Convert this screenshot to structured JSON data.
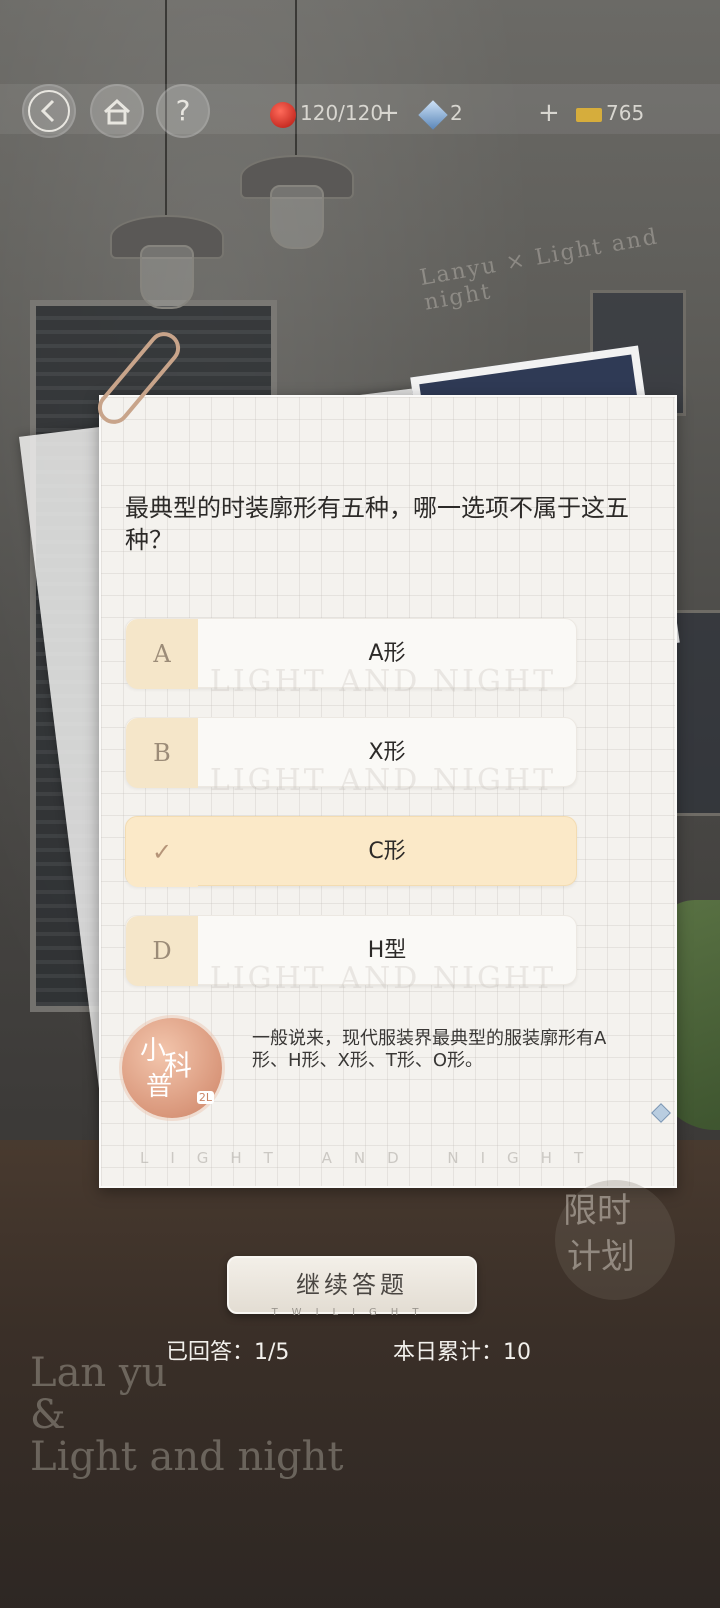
{
  "topbar": {
    "back_icon": "back-arrow-icon",
    "home_icon": "home-icon",
    "help_label": "?",
    "stamina": "120/120",
    "stamina_icon": "apple-icon",
    "gems": "2",
    "gem_icon": "diamond-icon",
    "tickets": "765",
    "ticket_icon": "ticket-icon",
    "plus": "+"
  },
  "background": {
    "wall_sign": "Lanyu × Light and night",
    "logo_line1": "Lan yu",
    "logo_line2": "&",
    "logo_line3": "Light and night"
  },
  "quiz": {
    "question": "最典型的时装廓形有五种，哪一选项不属于这五种？",
    "watermark": "LIGHT AND NIGHT",
    "options": [
      {
        "letter": "A",
        "text": "A形",
        "selected": false
      },
      {
        "letter": "B",
        "text": "X形",
        "selected": false
      },
      {
        "letter": "✓",
        "text": "C形",
        "selected": true
      },
      {
        "letter": "D",
        "text": "H型",
        "selected": false
      }
    ],
    "badge": {
      "c1": "小",
      "c2": "科",
      "c3": "普",
      "tag": "2L"
    },
    "explanation": "一般说来，现代服装界最典型的服装廓形有A形、H形、X形、T形、O形。",
    "card_footer": "LIGHT AND NIGHT"
  },
  "bottom": {
    "continue_label": "继续答题",
    "continue_sub": "TWILIGHT",
    "answered": "已回答：1/5",
    "daily_total": "本日累计：10",
    "limited_1": "限时",
    "limited_2": "计划"
  },
  "colors": {
    "accent": "#fbe9c8",
    "letter_bg": "#f5e6c9",
    "text_dark": "#2c2a28"
  }
}
